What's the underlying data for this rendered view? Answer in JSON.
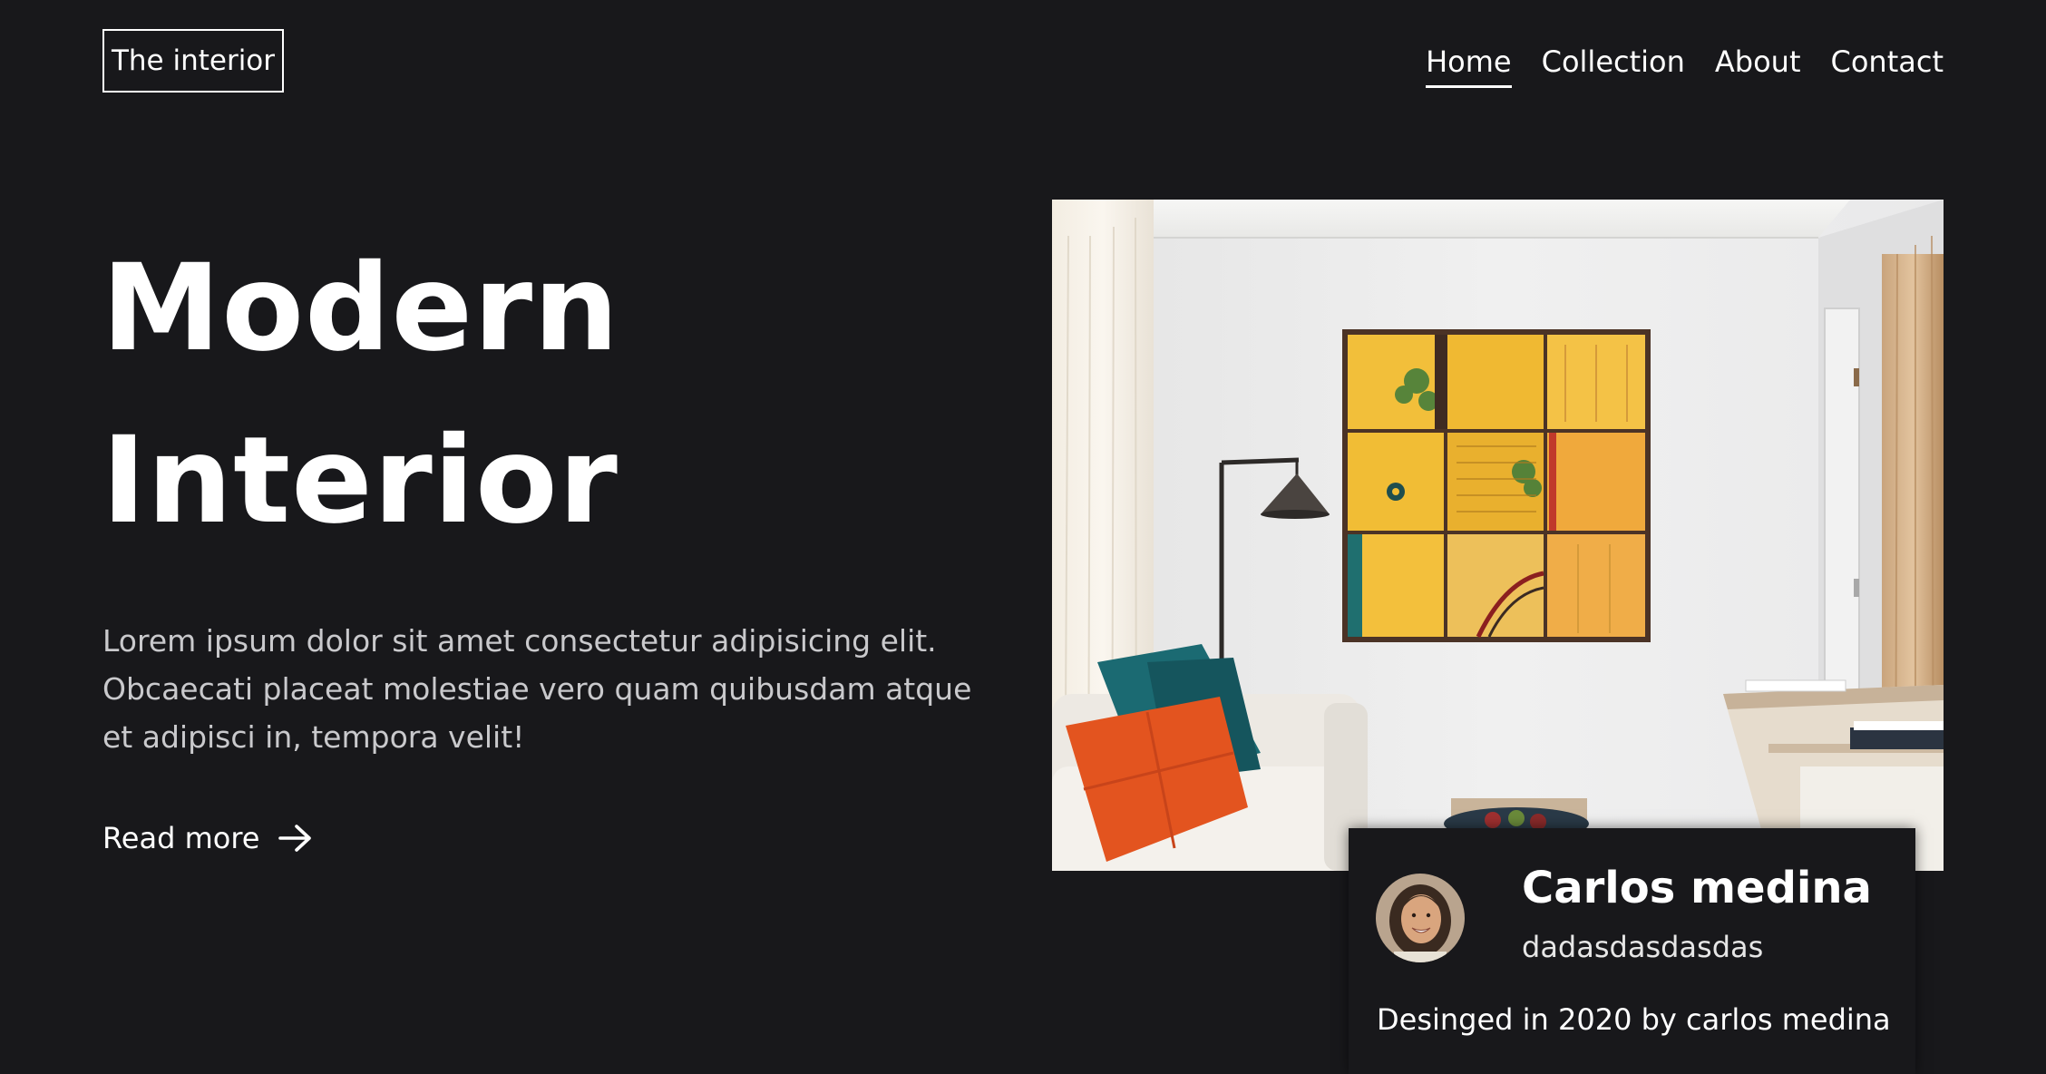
{
  "header": {
    "logo": "The interior",
    "nav": [
      {
        "label": "Home",
        "active": true
      },
      {
        "label": "Collection",
        "active": false
      },
      {
        "label": "About",
        "active": false
      },
      {
        "label": "Contact",
        "active": false
      }
    ]
  },
  "hero": {
    "title_line1": "Modern",
    "title_line2": "Interior",
    "description": "Lorem ipsum dolor sit amet consectetur adipisicing elit. Obcaecati placeat molestiae vero quam quibusdam atque et adipisci in, tempora velit!",
    "read_more": "Read more",
    "read_more_icon": "arrow-right-icon"
  },
  "card": {
    "name": "Carlos medina",
    "subtitle": "dadasdasdasdas",
    "credit": "Desinged in 2020 by carlos medina"
  },
  "colors": {
    "background": "#18181b",
    "text": "#ffffff",
    "muted_text": "#c9c9cc"
  }
}
